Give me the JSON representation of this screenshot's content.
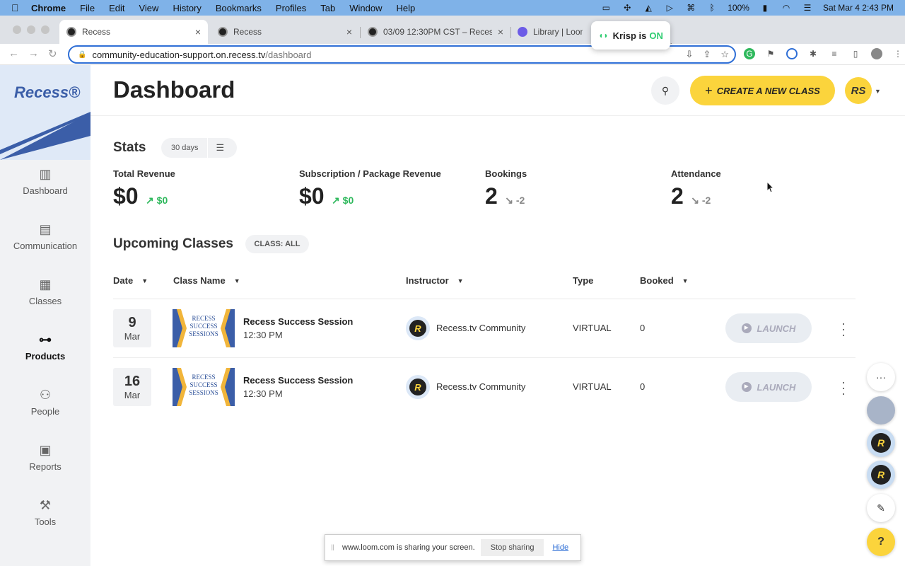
{
  "menubar": {
    "app": "Chrome",
    "items": [
      "File",
      "Edit",
      "View",
      "History",
      "Bookmarks",
      "Profiles",
      "Tab",
      "Window",
      "Help"
    ],
    "battery": "100%",
    "datetime": "Sat Mar 4  2:43 PM"
  },
  "tabs": [
    {
      "label": "Recess",
      "active": true
    },
    {
      "label": "Recess",
      "active": false
    },
    {
      "label": "03/09 12:30PM CST – Recess",
      "active": false
    },
    {
      "label": "Library | Loom",
      "active": false
    }
  ],
  "krisp": {
    "label": "Krisp is",
    "state": "ON"
  },
  "address": {
    "domain": "community-education-support.on.recess.tv",
    "path": "/dashboard"
  },
  "sidebar": {
    "logo": "Recess®",
    "items": [
      {
        "label": "Dashboard",
        "icon": "bar-chart-icon",
        "glyph": "▥",
        "active": false
      },
      {
        "label": "Communication",
        "icon": "message-icon",
        "glyph": "▤",
        "active": false
      },
      {
        "label": "Classes",
        "icon": "calendar-icon",
        "glyph": "▦",
        "active": false
      },
      {
        "label": "Products",
        "icon": "dumbbell-icon",
        "glyph": "⊶",
        "active": true
      },
      {
        "label": "People",
        "icon": "people-icon",
        "glyph": "⚇",
        "active": false
      },
      {
        "label": "Reports",
        "icon": "clipboard-icon",
        "glyph": "▣",
        "active": false
      },
      {
        "label": "Tools",
        "icon": "tools-icon",
        "glyph": "⚒",
        "active": false
      }
    ]
  },
  "header": {
    "title": "Dashboard",
    "create_label": "CREATE A NEW CLASS",
    "avatar_initials": "RS"
  },
  "stats": {
    "title": "Stats",
    "filter": "30 days",
    "items": [
      {
        "label": "Total Revenue",
        "value": "$0",
        "delta": "$0",
        "trend": "up"
      },
      {
        "label": "Subscription / Package Revenue",
        "value": "$0",
        "delta": "$0",
        "trend": "up"
      },
      {
        "label": "Bookings",
        "value": "2",
        "delta": "-2",
        "trend": "down"
      },
      {
        "label": "Attendance",
        "value": "2",
        "delta": "-2",
        "trend": "down"
      }
    ]
  },
  "upcoming": {
    "title": "Upcoming Classes",
    "filter": "CLASS: ALL",
    "columns": [
      {
        "label": "Date",
        "sortable": true
      },
      {
        "label": "Class Name",
        "sortable": true
      },
      {
        "label": "Instructor",
        "sortable": true
      },
      {
        "label": "Type",
        "sortable": false
      },
      {
        "label": "Booked",
        "sortable": true
      }
    ],
    "rows": [
      {
        "day": "9",
        "month": "Mar",
        "thumb": "RECESS SUCCESS SESSIONS",
        "name": "Recess Success Session",
        "time": "12:30 PM",
        "instructor": "Recess.tv Community",
        "type": "VIRTUAL",
        "booked": "0",
        "action": "LAUNCH"
      },
      {
        "day": "16",
        "month": "Mar",
        "thumb": "RECESS SUCCESS SESSIONS",
        "name": "Recess Success Session",
        "time": "12:30 PM",
        "instructor": "Recess.tv Community",
        "type": "VIRTUAL",
        "booked": "0",
        "action": "LAUNCH"
      }
    ]
  },
  "loom": {
    "message": "www.loom.com is sharing your screen.",
    "stop": "Stop sharing",
    "hide": "Hide"
  },
  "colors": {
    "accent": "#fbd43c",
    "brand": "#3b5ea8",
    "positive": "#2eb85c"
  }
}
